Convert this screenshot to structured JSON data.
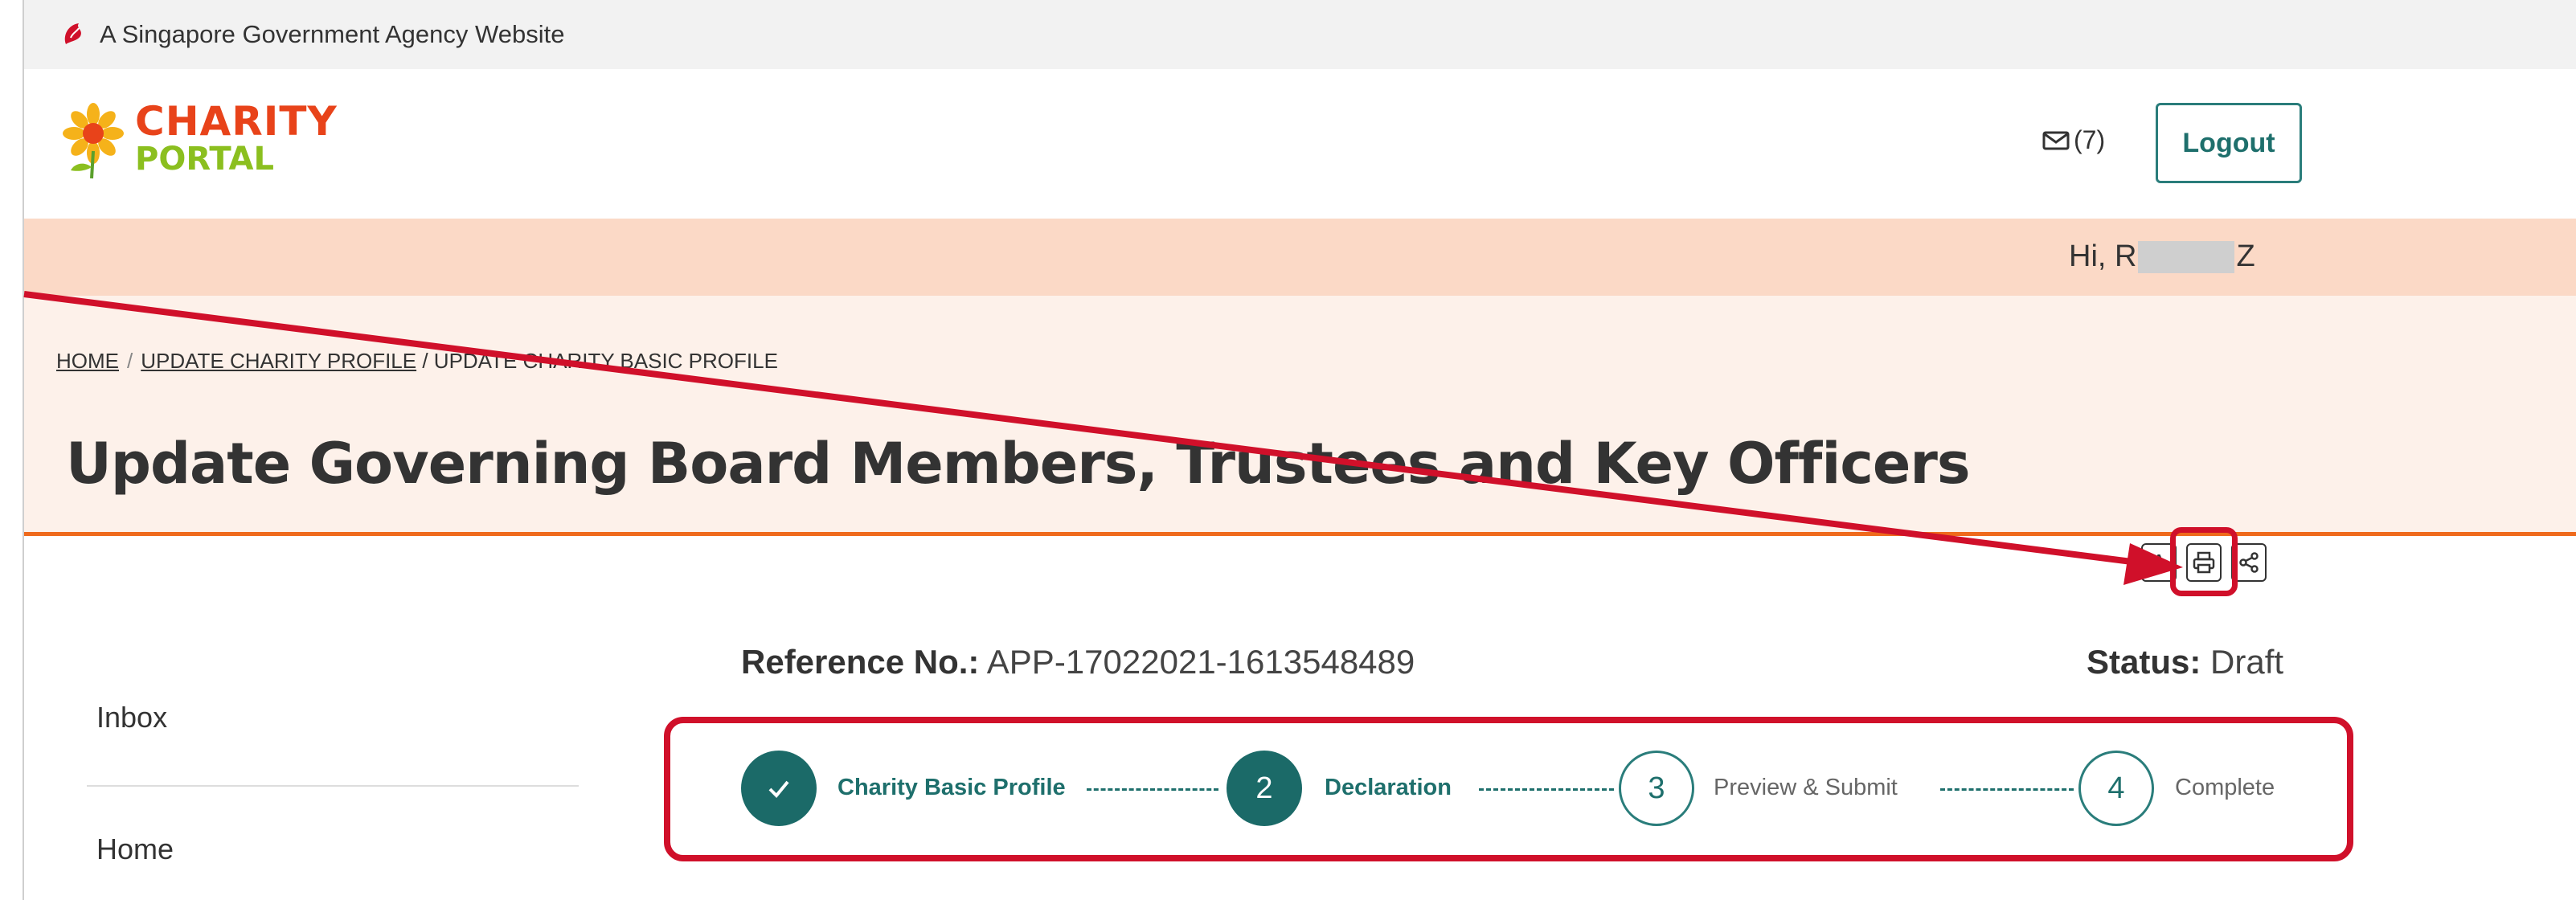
{
  "gov_banner": {
    "text": "A Singapore Government Agency Website"
  },
  "logo": {
    "line1": "CHARITY",
    "line2": "PORTAL"
  },
  "header": {
    "mail_count": "(7)",
    "logout_label": "Logout"
  },
  "greeting": {
    "prefix": "Hi, R",
    "suffix": "Z"
  },
  "breadcrumb": {
    "home": "HOME",
    "sep": "/",
    "update_profile": "UPDATE CHARITY PROFILE",
    "current": "/ UPDATE CHARITY BASIC PROFILE"
  },
  "page": {
    "title": "Update Governing Board Members, Trustees and Key Officers"
  },
  "toolbar": {
    "font_icon_text": "A"
  },
  "sidebar": {
    "items": [
      {
        "label": "Inbox"
      },
      {
        "label": "Home"
      }
    ]
  },
  "application": {
    "ref_label": "Reference No.:",
    "ref_value": "APP-17022021-1613548489",
    "status_label": "Status:",
    "status_value": "Draft"
  },
  "steps": [
    {
      "number": "✓",
      "label": "Charity Basic Profile",
      "state": "done"
    },
    {
      "number": "2",
      "label": "Declaration",
      "state": "current"
    },
    {
      "number": "3",
      "label": "Preview & Submit",
      "state": "pending"
    },
    {
      "number": "4",
      "label": "Complete",
      "state": "pending"
    }
  ],
  "colors": {
    "teal": "#1b6a68",
    "accent_orange": "#ef6a1c",
    "annotation_red": "#d0102a",
    "greeting_bg": "#fbd9c6"
  }
}
